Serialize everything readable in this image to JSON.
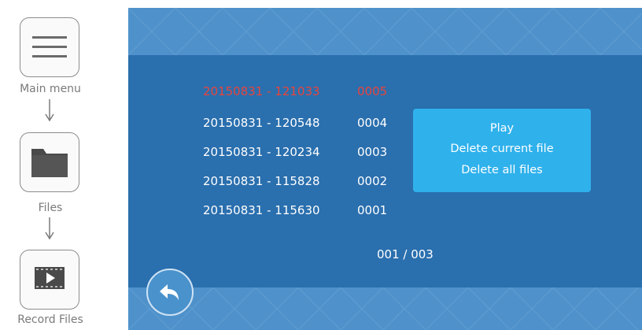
{
  "nav": {
    "main_menu_label": "Main menu",
    "files_label": "Files",
    "record_files_label": "Record Files"
  },
  "file_list": [
    {
      "name": "20150831 - 121033",
      "number": "0005",
      "selected": true
    },
    {
      "name": "20150831 - 120548",
      "number": "0004",
      "selected": false
    },
    {
      "name": "20150831 - 120234",
      "number": "0003",
      "selected": false
    },
    {
      "name": "20150831 - 115828",
      "number": "0002",
      "selected": false
    },
    {
      "name": "20150831 - 115630",
      "number": "0001",
      "selected": false
    }
  ],
  "popup_menu": {
    "items": [
      "Play",
      "Delete current file",
      "Delete all files"
    ]
  },
  "pagination": {
    "text": "001 / 003"
  },
  "icons": {
    "main_menu": "hamburger-menu-icon",
    "files": "folder-icon",
    "record_files": "film-play-icon",
    "back": "back-arrow-icon",
    "flow": "arrow-down-icon"
  },
  "colors": {
    "screen_bg": "#2a6fae",
    "band": "#4f92cb",
    "popup_bg": "#2fb1ec",
    "selected_text": "#e8443d",
    "text": "#ffffff"
  }
}
